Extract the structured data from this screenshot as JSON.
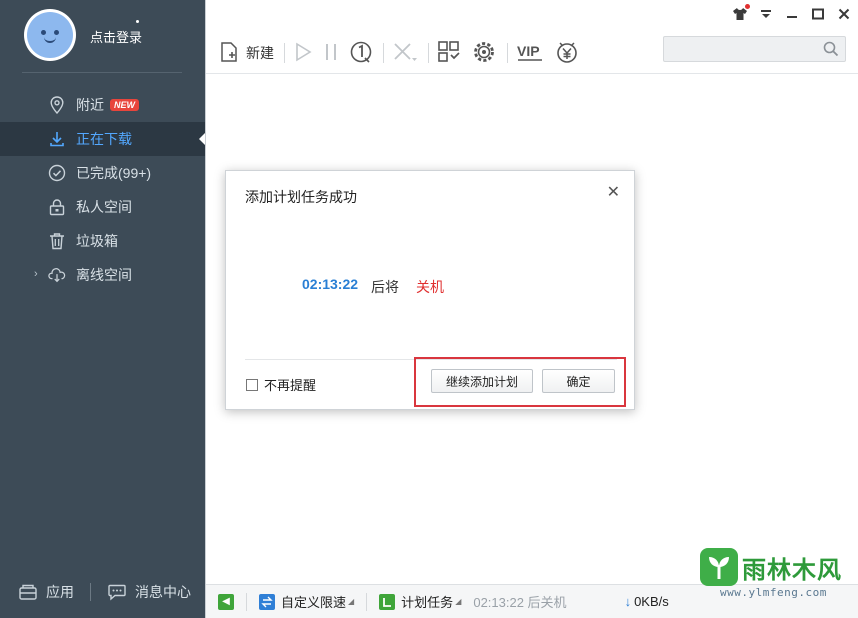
{
  "sidebar": {
    "login_label": "点击登录",
    "items": [
      {
        "label": "附近",
        "badge": "NEW",
        "icon": "location-pin-icon"
      },
      {
        "label": "正在下载",
        "icon": "download-icon",
        "active": true
      },
      {
        "label": "已完成(99+)",
        "icon": "check-circle-icon"
      },
      {
        "label": "私人空间",
        "icon": "lock-icon"
      },
      {
        "label": "垃圾箱",
        "icon": "trash-icon"
      },
      {
        "label": "离线空间",
        "icon": "cloud-download-icon"
      }
    ],
    "bottom": {
      "apps_label": "应用",
      "messages_label": "消息中心"
    }
  },
  "toolbar": {
    "new_label": "新建",
    "icons": [
      "new-file-icon",
      "play-icon",
      "pause-icon",
      "speed-limit-icon",
      "delete-icon",
      "qr-code-icon",
      "settings-gear-icon",
      "vip-icon",
      "yuan-icon"
    ]
  },
  "dialog": {
    "title": "添加计划任务成功",
    "time": "02:13:22",
    "after_text": "后将",
    "action": "关机",
    "dont_remind_label": "不再提醒",
    "continue_button": "继续添加计划",
    "ok_button": "确定"
  },
  "statusbar": {
    "custom_speed_label": "自定义限速",
    "schedule_label": "计划任务",
    "schedule_status": "02:13:22 后关机",
    "download_speed": "0KB/s"
  },
  "watermark": {
    "name": "雨林木风",
    "url": "www.ylmfeng.com"
  },
  "colors": {
    "sidebar_bg": "#3d4b57",
    "active_item_bg": "#2c3843",
    "accent_blue": "#2a7fd4",
    "alert_red": "#e02f2f",
    "highlight_border": "#d9363e",
    "status_green": "#3fa53a"
  }
}
